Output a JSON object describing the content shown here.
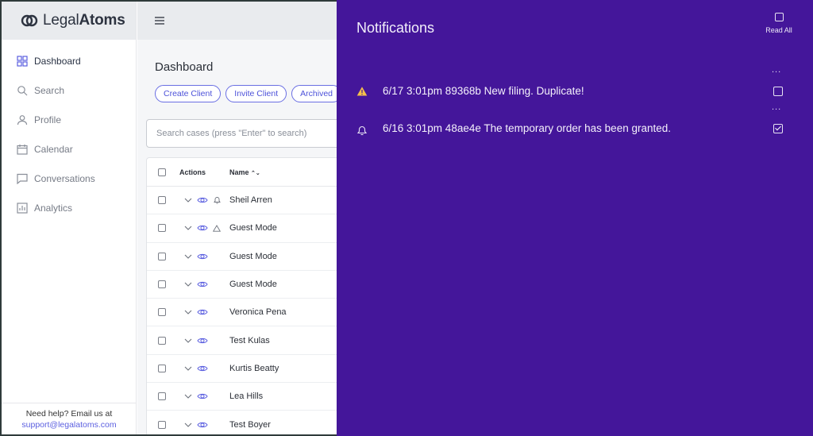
{
  "app": {
    "logo_prefix": "Legal",
    "logo_suffix": "Atoms"
  },
  "sidebar": {
    "items": [
      {
        "label": "Dashboard",
        "icon": "grid-icon"
      },
      {
        "label": "Search",
        "icon": "search-icon"
      },
      {
        "label": "Profile",
        "icon": "user-icon"
      },
      {
        "label": "Calendar",
        "icon": "calendar-icon"
      },
      {
        "label": "Conversations",
        "icon": "chat-icon"
      },
      {
        "label": "Analytics",
        "icon": "chart-icon"
      }
    ],
    "help_text": "Need help? Email us at",
    "help_email": "support@legalatoms.com"
  },
  "main": {
    "title": "Dashboard",
    "buttons": {
      "create_client": "Create Client",
      "invite_client": "Invite Client",
      "archived": "Archived"
    },
    "search_placeholder": "Search cases (press \"Enter\" to search)",
    "table": {
      "col_actions": "Actions",
      "col_name": "Name",
      "rows": [
        {
          "name": "Sheil Arren"
        },
        {
          "name": "Guest Mode"
        },
        {
          "name": "Guest Mode"
        },
        {
          "name": "Guest Mode"
        },
        {
          "name": "Veronica Pena"
        },
        {
          "name": "Test Kulas"
        },
        {
          "name": "Kurtis Beatty"
        },
        {
          "name": "Lea Hills"
        },
        {
          "name": "Test Boyer"
        }
      ]
    }
  },
  "notifications": {
    "title": "Notifications",
    "read_all": "Read All",
    "more": "...",
    "items": [
      {
        "text": "6/17 3:01pm 89368b  New filing. Duplicate!",
        "icon": "warning-icon",
        "checked": false
      },
      {
        "text": "6/16 3:01pm 48ae4e The temporary order has been granted.",
        "icon": "bell-icon",
        "checked": true
      }
    ]
  },
  "colors": {
    "panel": "#44169a",
    "accent": "#5b5fe0",
    "warning": "#f5c04a"
  }
}
